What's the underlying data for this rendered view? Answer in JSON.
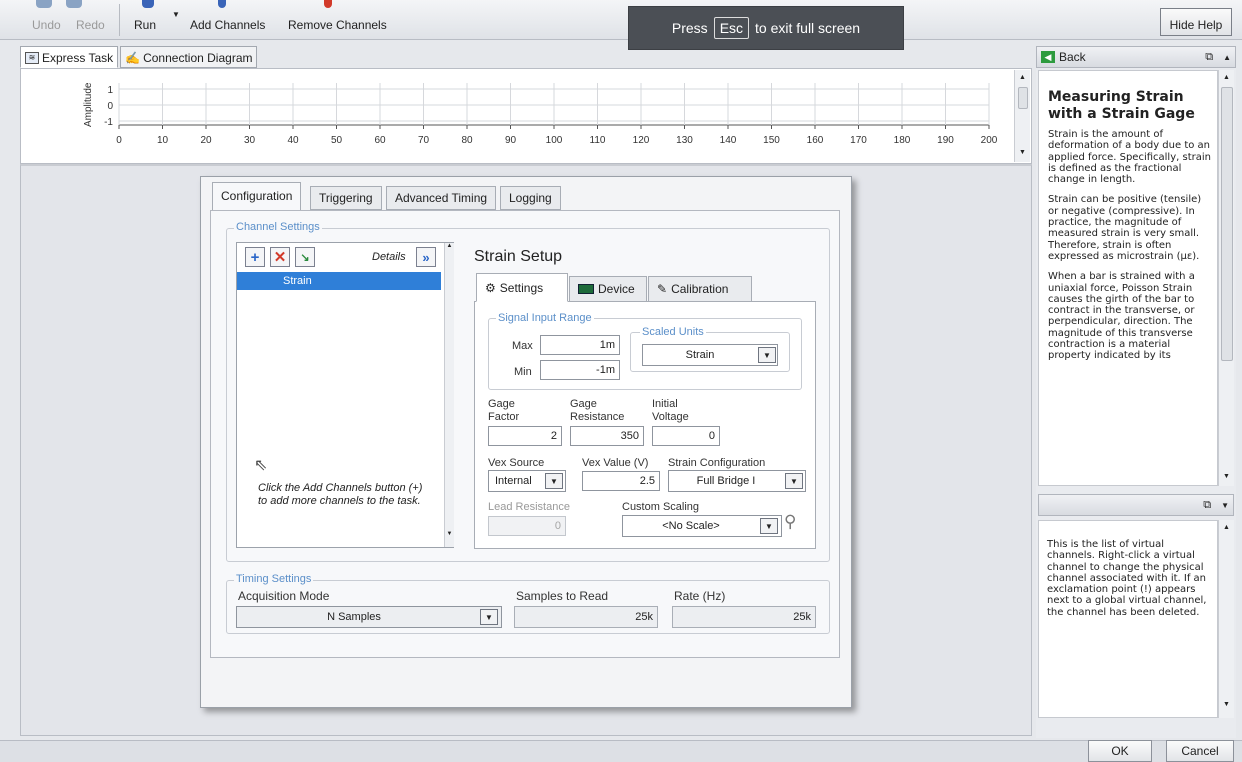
{
  "toolbar": {
    "undo": "Undo",
    "redo": "Redo",
    "run": "Run",
    "add_channels": "Add Channels",
    "remove_channels": "Remove Channels",
    "hide_help": "Hide Help"
  },
  "fullscreen_notice": {
    "press": "Press",
    "key": "Esc",
    "rest": "to exit full screen"
  },
  "top_tabs": {
    "express_task": "Express Task",
    "connection_diagram": "Connection Diagram"
  },
  "graph": {
    "ylabel": "Amplitude",
    "y_ticks": [
      "1",
      "0",
      "-1"
    ],
    "x_ticks": [
      "0",
      "10",
      "20",
      "30",
      "40",
      "50",
      "60",
      "70",
      "80",
      "90",
      "100",
      "110",
      "120",
      "130",
      "140",
      "150",
      "160",
      "170",
      "180",
      "190",
      "200"
    ]
  },
  "dialog_tabs": {
    "configuration": "Configuration",
    "triggering": "Triggering",
    "advanced_timing": "Advanced Timing",
    "logging": "Logging"
  },
  "channel_settings": {
    "group_label": "Channel Settings",
    "details": "Details",
    "channel": "Strain",
    "hint": "Click the Add Channels button (+) to add more channels to the task."
  },
  "strain_setup": {
    "title": "Strain Setup",
    "tabs": {
      "settings": "Settings",
      "device": "Device",
      "calibration": "Calibration"
    },
    "signal_input_range": "Signal Input Range",
    "max_label": "Max",
    "max_value": "1m",
    "min_label": "Min",
    "min_value": "-1m",
    "scaled_units_label": "Scaled Units",
    "scaled_units": "Strain",
    "gage_factor_label1": "Gage",
    "gage_factor_label2": "Factor",
    "gage_factor": "2",
    "gage_resistance_label1": "Gage",
    "gage_resistance_label2": "Resistance",
    "gage_resistance": "350",
    "initial_voltage_label1": "Initial",
    "initial_voltage_label2": "Voltage",
    "initial_voltage": "0",
    "vex_source_label": "Vex Source",
    "vex_source": "Internal",
    "vex_value_label": "Vex Value (V)",
    "vex_value": "2.5",
    "strain_config_label": "Strain Configuration",
    "strain_config": "Full Bridge I",
    "lead_resistance_label": "Lead Resistance",
    "lead_resistance": "0",
    "custom_scaling_label": "Custom Scaling",
    "custom_scaling": "<No Scale>"
  },
  "timing": {
    "group_label": "Timing Settings",
    "acq_mode_label": "Acquisition Mode",
    "acq_mode": "N Samples",
    "samples_label": "Samples to Read",
    "samples": "25k",
    "rate_label": "Rate (Hz)",
    "rate": "25k"
  },
  "help": {
    "back": "Back",
    "title": "Measuring Strain with a Strain Gage",
    "p1": "Strain is the amount of deformation of a body due to an applied force. Specifically, strain is defined as the fractional change in length.",
    "p2": "Strain can be positive (tensile) or negative (compressive). In practice, the magnitude of measured strain is very small. Therefore, strain is often expressed as microstrain (µε).",
    "p3": "When a bar is strained with a uniaxial force, Poisson Strain causes the girth of the bar to contract in the transverse, or perpendicular, direction. The magnitude of this transverse contraction is a material property indicated by its",
    "context": "This is the list of virtual channels. Right-click a virtual channel to change the physical channel associated with it. If an exclamation point (!) appears next to a global virtual channel, the channel has been deleted."
  },
  "buttons": {
    "ok": "OK",
    "cancel": "Cancel"
  },
  "colors": {
    "selection": "#2f7fd8",
    "group_label": "#5b8fc9",
    "remove_red": "#d23a2a",
    "add_blue": "#2a66c8"
  }
}
